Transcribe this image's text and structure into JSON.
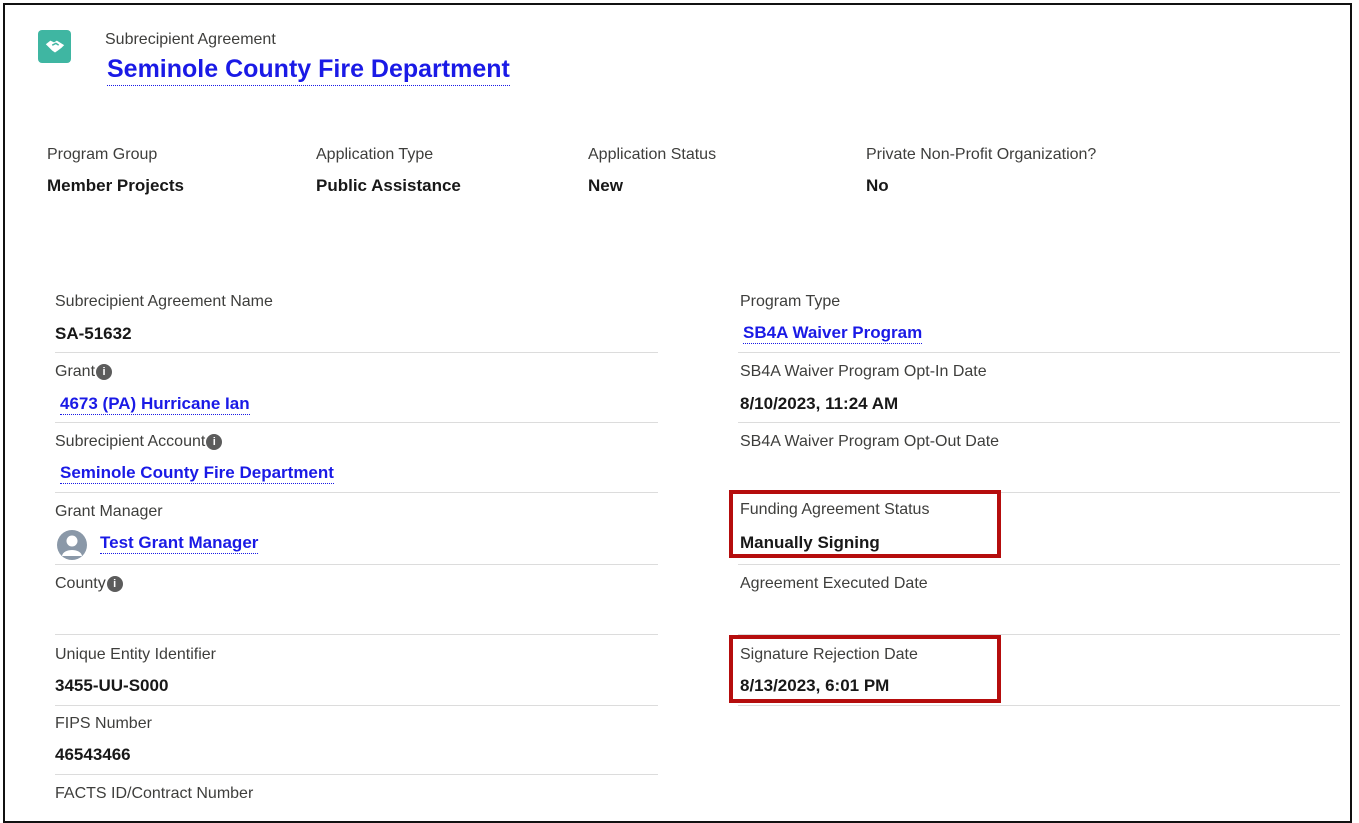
{
  "header": {
    "object_label": "Subrecipient Agreement",
    "record_title": "Seminole County Fire Department",
    "icon": "handshake-icon",
    "icon_color": "#3fb6a2"
  },
  "highlights": [
    {
      "label": "Program Group",
      "value": "Member Projects"
    },
    {
      "label": "Application Type",
      "value": "Public Assistance"
    },
    {
      "label": "Application Status",
      "value": "New"
    },
    {
      "label": "Private Non-Profit Organization?",
      "value": "No"
    }
  ],
  "left_fields": {
    "agreement_name": {
      "label": "Subrecipient Agreement Name",
      "value": "SA-51632"
    },
    "grant": {
      "label": "Grant",
      "value": "4673 (PA) Hurricane Ian"
    },
    "subrecipient_account": {
      "label": "Subrecipient Account",
      "value": "Seminole County Fire Department"
    },
    "grant_manager": {
      "label": "Grant Manager",
      "value": "Test Grant Manager"
    },
    "county": {
      "label": "County",
      "value": ""
    },
    "uei": {
      "label": "Unique Entity Identifier",
      "value": "3455-UU-S000"
    },
    "fips": {
      "label": "FIPS Number",
      "value": "46543466"
    },
    "facts_id": {
      "label": "FACTS ID/Contract Number",
      "value": ""
    }
  },
  "right_fields": {
    "program_type": {
      "label": "Program Type",
      "value": "SB4A Waiver Program"
    },
    "opt_in_date": {
      "label": "SB4A Waiver Program Opt-In Date",
      "value": "8/10/2023, 11:24 AM"
    },
    "opt_out_date": {
      "label": "SB4A Waiver Program Opt-Out Date",
      "value": ""
    },
    "funding_status": {
      "label": "Funding Agreement Status",
      "value": "Manually Signing"
    },
    "executed_date": {
      "label": "Agreement Executed Date",
      "value": ""
    },
    "rejection_date": {
      "label": "Signature Rejection Date",
      "value": "8/13/2023, 6:01 PM"
    }
  },
  "colors": {
    "link": "#1a1ae6",
    "highlight_border": "#b50d0d",
    "info_icon": "#5c5c5c"
  }
}
